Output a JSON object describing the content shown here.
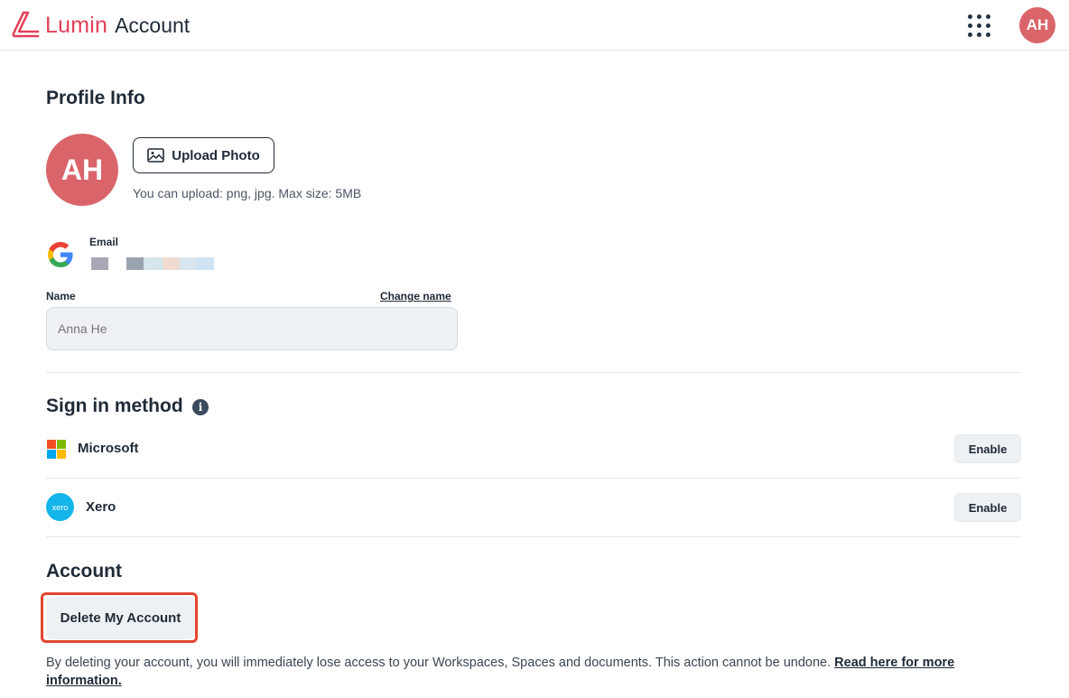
{
  "header": {
    "brand": "Lumin",
    "brand_sub": "Account",
    "avatar_initials": "AH",
    "apps_icon": "grid-apps-icon"
  },
  "colors": {
    "brand": "#e2405a",
    "avatar": "#d9656b",
    "highlight": "#e2452f",
    "text": "#1f2a37"
  },
  "profile": {
    "title": "Profile Info",
    "avatar_initials": "AH",
    "upload_label": "Upload Photo",
    "upload_hint": "You can upload: png, jpg. Max size: 5MB",
    "email_label": "Email",
    "name_label": "Name",
    "change_name_label": "Change name",
    "name_placeholder": "Anna He"
  },
  "sign_in": {
    "title": "Sign in method",
    "methods": [
      {
        "name": "Microsoft",
        "icon": "microsoft-icon",
        "action": "Enable"
      },
      {
        "name": "Xero",
        "icon": "xero-icon",
        "icon_text": "xero",
        "action": "Enable"
      }
    ]
  },
  "account": {
    "title": "Account",
    "delete_label": "Delete My Account",
    "delete_description": "By deleting your account, you will immediately lose access to your Workspaces, Spaces and documents. This action cannot be undone.",
    "read_more_label": "Read here for more information."
  }
}
